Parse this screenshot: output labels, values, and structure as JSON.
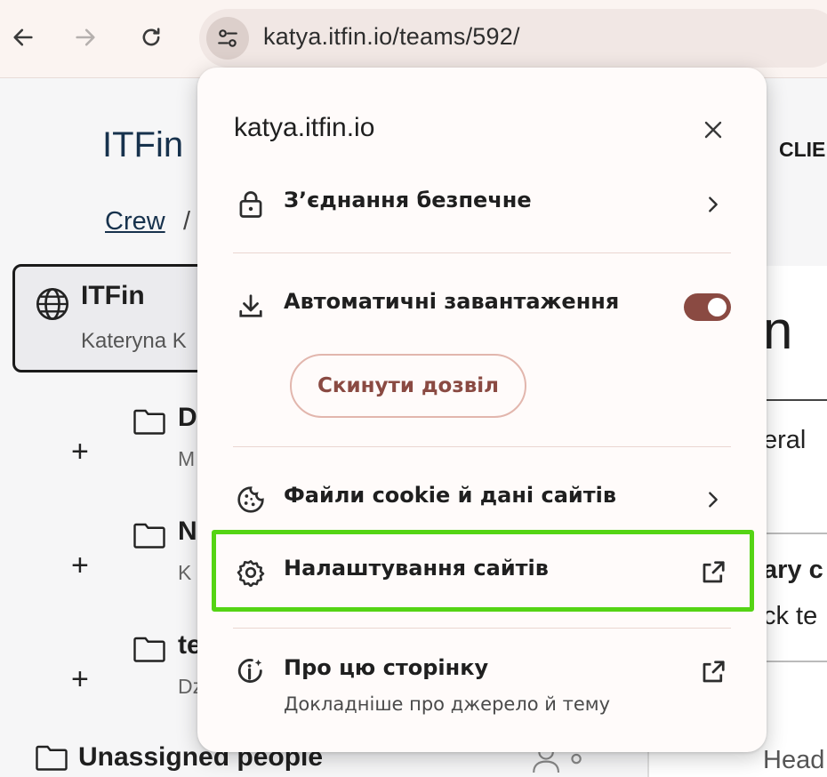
{
  "browser": {
    "url": "katya.itfin.io/teams/592/",
    "icons": {
      "back": "arrow-left-icon",
      "forward": "arrow-right-icon",
      "reload": "reload-icon",
      "site_info": "tune-icon"
    }
  },
  "background": {
    "brand": "ITFin",
    "clients_tab": "CLIE",
    "breadcrumb_link": "Crew",
    "breadcrumb_sep": "/",
    "org": {
      "name": "ITFin",
      "owner": "Kateryna K"
    },
    "teams": [
      {
        "name": "D",
        "sub": "M"
      },
      {
        "name": "N",
        "sub": "K"
      },
      {
        "name": "te",
        "sub": "Dz"
      }
    ],
    "unassigned": "Unassigned people",
    "right_panel": {
      "heading": "n",
      "t1": "eral",
      "t2": "ary c",
      "t3": "ck te",
      "t4": "Head"
    }
  },
  "popup": {
    "title": "katya.itfin.io",
    "items": {
      "connection": {
        "label": "З’єднання безпечне",
        "icon": "lock-icon"
      },
      "downloads": {
        "label": "Автоматичні завантаження",
        "icon": "download-icon",
        "toggle_on": true
      },
      "reset_button": "Скинути дозвіл",
      "cookies": {
        "label": "Файли cookie й дані сайтів",
        "icon": "cookie-icon"
      },
      "site_settings": {
        "label": "Налаштування сайтів",
        "icon": "gear-icon"
      },
      "about": {
        "label": "Про цю сторінку",
        "sub": "Докладніше про джерело й тему",
        "icon": "info-sparkle-icon"
      }
    },
    "highlight_color": "#55d414",
    "accent_color": "#8a4a42"
  }
}
